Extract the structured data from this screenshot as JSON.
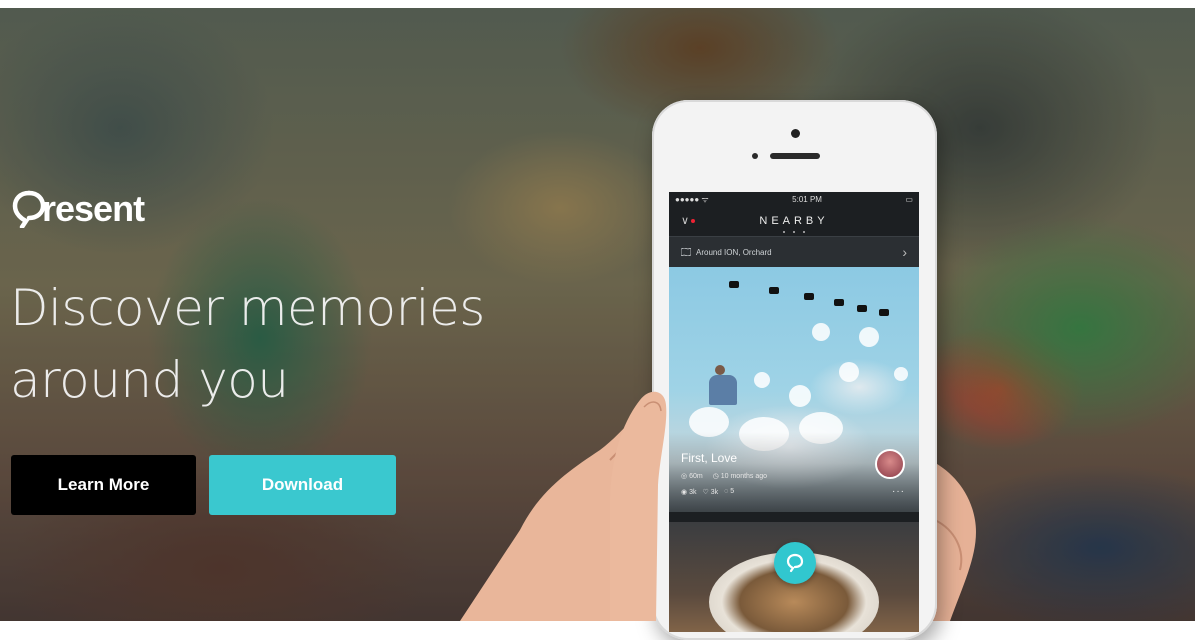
{
  "brand": {
    "name": "resent"
  },
  "hero": {
    "headline_line1": "Discover memories",
    "headline_line2": "around you"
  },
  "buttons": {
    "learn_more": "Learn More",
    "download": "Download"
  },
  "phone": {
    "status": {
      "carrier": "●●●●● ᯤ",
      "time": "5:01 PM",
      "battery": "▭"
    },
    "nav": {
      "title": "NEARBY",
      "left": "∨"
    },
    "location": {
      "label": "Around ION, Orchard"
    },
    "card": {
      "title": "First, Love",
      "distance": "60m",
      "time_ago": "10 months ago",
      "views": "3k",
      "likes": "3k",
      "comments": "5",
      "more": "···"
    }
  },
  "colors": {
    "accent": "#3ac8cf",
    "dark_button": "#000000"
  }
}
